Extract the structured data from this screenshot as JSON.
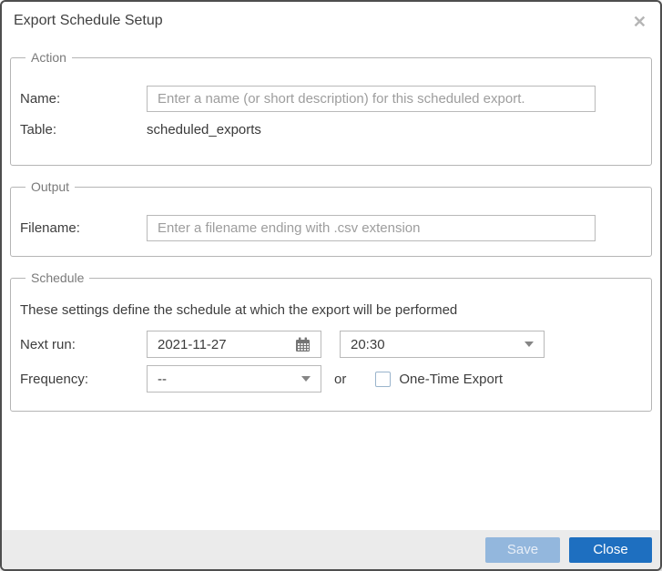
{
  "dialog": {
    "title": "Export Schedule Setup",
    "close_icon": "✕"
  },
  "action_section": {
    "legend": "Action",
    "name_label": "Name:",
    "name_placeholder": "Enter a name (or short description) for this scheduled export.",
    "name_value": "",
    "table_label": "Table:",
    "table_value": "scheduled_exports"
  },
  "output_section": {
    "legend": "Output",
    "filename_label": "Filename:",
    "filename_placeholder": "Enter a filename ending with .csv extension",
    "filename_value": ""
  },
  "schedule_section": {
    "legend": "Schedule",
    "description": "These settings define the schedule at which the export will be performed",
    "next_run_label": "Next run:",
    "next_run_date": "2021-11-27",
    "next_run_time": "20:30",
    "frequency_label": "Frequency:",
    "frequency_value": "--",
    "or_label": "or",
    "one_time_label": "One-Time Export",
    "one_time_checked": false
  },
  "footer": {
    "save_label": "Save",
    "close_label": "Close"
  },
  "icons": {
    "calendar": "calendar-icon",
    "caret": "chevron-down-icon"
  },
  "colors": {
    "save_button": "#93b7dd",
    "close_button": "#1e6fc0",
    "footer_bg": "#ebebeb",
    "dialog_border": "#4e4e4e",
    "fieldset_border": "#b5b5b5",
    "legend_text": "#7a7a7a",
    "placeholder_text": "#9d9d9d"
  }
}
